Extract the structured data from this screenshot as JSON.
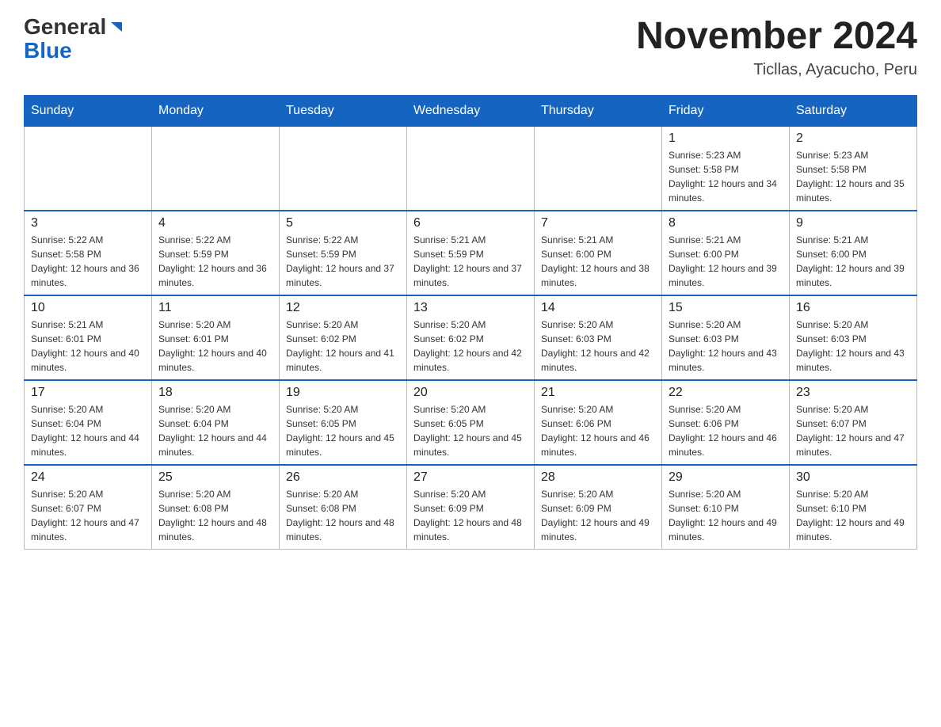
{
  "header": {
    "logo_general": "General",
    "logo_blue": "Blue",
    "month_year": "November 2024",
    "location": "Ticllas, Ayacucho, Peru"
  },
  "days_of_week": [
    "Sunday",
    "Monday",
    "Tuesday",
    "Wednesday",
    "Thursday",
    "Friday",
    "Saturday"
  ],
  "weeks": [
    [
      {
        "day": "",
        "info": ""
      },
      {
        "day": "",
        "info": ""
      },
      {
        "day": "",
        "info": ""
      },
      {
        "day": "",
        "info": ""
      },
      {
        "day": "",
        "info": ""
      },
      {
        "day": "1",
        "info": "Sunrise: 5:23 AM\nSunset: 5:58 PM\nDaylight: 12 hours and 34 minutes."
      },
      {
        "day": "2",
        "info": "Sunrise: 5:23 AM\nSunset: 5:58 PM\nDaylight: 12 hours and 35 minutes."
      }
    ],
    [
      {
        "day": "3",
        "info": "Sunrise: 5:22 AM\nSunset: 5:58 PM\nDaylight: 12 hours and 36 minutes."
      },
      {
        "day": "4",
        "info": "Sunrise: 5:22 AM\nSunset: 5:59 PM\nDaylight: 12 hours and 36 minutes."
      },
      {
        "day": "5",
        "info": "Sunrise: 5:22 AM\nSunset: 5:59 PM\nDaylight: 12 hours and 37 minutes."
      },
      {
        "day": "6",
        "info": "Sunrise: 5:21 AM\nSunset: 5:59 PM\nDaylight: 12 hours and 37 minutes."
      },
      {
        "day": "7",
        "info": "Sunrise: 5:21 AM\nSunset: 6:00 PM\nDaylight: 12 hours and 38 minutes."
      },
      {
        "day": "8",
        "info": "Sunrise: 5:21 AM\nSunset: 6:00 PM\nDaylight: 12 hours and 39 minutes."
      },
      {
        "day": "9",
        "info": "Sunrise: 5:21 AM\nSunset: 6:00 PM\nDaylight: 12 hours and 39 minutes."
      }
    ],
    [
      {
        "day": "10",
        "info": "Sunrise: 5:21 AM\nSunset: 6:01 PM\nDaylight: 12 hours and 40 minutes."
      },
      {
        "day": "11",
        "info": "Sunrise: 5:20 AM\nSunset: 6:01 PM\nDaylight: 12 hours and 40 minutes."
      },
      {
        "day": "12",
        "info": "Sunrise: 5:20 AM\nSunset: 6:02 PM\nDaylight: 12 hours and 41 minutes."
      },
      {
        "day": "13",
        "info": "Sunrise: 5:20 AM\nSunset: 6:02 PM\nDaylight: 12 hours and 42 minutes."
      },
      {
        "day": "14",
        "info": "Sunrise: 5:20 AM\nSunset: 6:03 PM\nDaylight: 12 hours and 42 minutes."
      },
      {
        "day": "15",
        "info": "Sunrise: 5:20 AM\nSunset: 6:03 PM\nDaylight: 12 hours and 43 minutes."
      },
      {
        "day": "16",
        "info": "Sunrise: 5:20 AM\nSunset: 6:03 PM\nDaylight: 12 hours and 43 minutes."
      }
    ],
    [
      {
        "day": "17",
        "info": "Sunrise: 5:20 AM\nSunset: 6:04 PM\nDaylight: 12 hours and 44 minutes."
      },
      {
        "day": "18",
        "info": "Sunrise: 5:20 AM\nSunset: 6:04 PM\nDaylight: 12 hours and 44 minutes."
      },
      {
        "day": "19",
        "info": "Sunrise: 5:20 AM\nSunset: 6:05 PM\nDaylight: 12 hours and 45 minutes."
      },
      {
        "day": "20",
        "info": "Sunrise: 5:20 AM\nSunset: 6:05 PM\nDaylight: 12 hours and 45 minutes."
      },
      {
        "day": "21",
        "info": "Sunrise: 5:20 AM\nSunset: 6:06 PM\nDaylight: 12 hours and 46 minutes."
      },
      {
        "day": "22",
        "info": "Sunrise: 5:20 AM\nSunset: 6:06 PM\nDaylight: 12 hours and 46 minutes."
      },
      {
        "day": "23",
        "info": "Sunrise: 5:20 AM\nSunset: 6:07 PM\nDaylight: 12 hours and 47 minutes."
      }
    ],
    [
      {
        "day": "24",
        "info": "Sunrise: 5:20 AM\nSunset: 6:07 PM\nDaylight: 12 hours and 47 minutes."
      },
      {
        "day": "25",
        "info": "Sunrise: 5:20 AM\nSunset: 6:08 PM\nDaylight: 12 hours and 48 minutes."
      },
      {
        "day": "26",
        "info": "Sunrise: 5:20 AM\nSunset: 6:08 PM\nDaylight: 12 hours and 48 minutes."
      },
      {
        "day": "27",
        "info": "Sunrise: 5:20 AM\nSunset: 6:09 PM\nDaylight: 12 hours and 48 minutes."
      },
      {
        "day": "28",
        "info": "Sunrise: 5:20 AM\nSunset: 6:09 PM\nDaylight: 12 hours and 49 minutes."
      },
      {
        "day": "29",
        "info": "Sunrise: 5:20 AM\nSunset: 6:10 PM\nDaylight: 12 hours and 49 minutes."
      },
      {
        "day": "30",
        "info": "Sunrise: 5:20 AM\nSunset: 6:10 PM\nDaylight: 12 hours and 49 minutes."
      }
    ]
  ]
}
